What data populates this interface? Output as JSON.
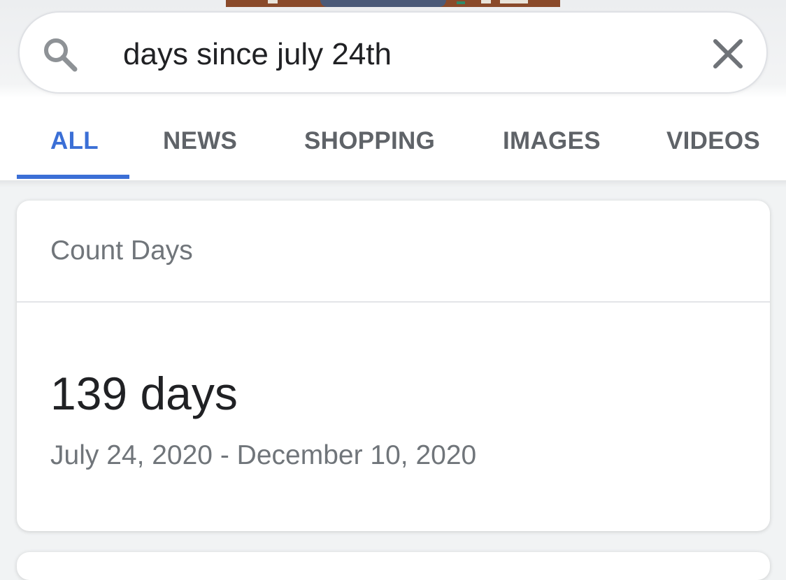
{
  "search": {
    "query": "days since july 24th",
    "search_icon": "search-icon",
    "clear_icon": "close-icon"
  },
  "tabs": [
    {
      "label": "ALL",
      "active": true
    },
    {
      "label": "NEWS",
      "active": false
    },
    {
      "label": "SHOPPING",
      "active": false
    },
    {
      "label": "IMAGES",
      "active": false
    },
    {
      "label": "VIDEOS",
      "active": false
    }
  ],
  "card": {
    "title": "Count Days",
    "result": "139 days",
    "range": "July 24, 2020 - December 10, 2020"
  },
  "colors": {
    "accent": "#3b6fd6",
    "text_primary": "#202124",
    "text_secondary": "#70757a"
  }
}
